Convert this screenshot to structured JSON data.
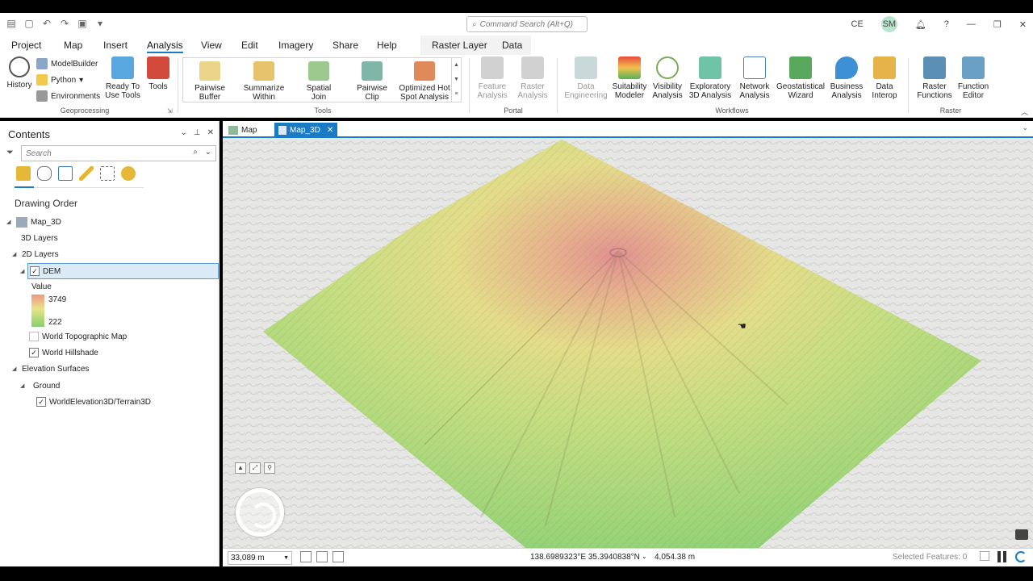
{
  "titlebar": {
    "command_search_placeholder": "Command Search (Alt+Q)",
    "user_initials": "CE",
    "avatar_initials": "SM",
    "help": "?"
  },
  "ribbon_tabs": [
    "Project",
    "Map",
    "Insert",
    "Analysis",
    "View",
    "Edit",
    "Imagery",
    "Share",
    "Help"
  ],
  "active_tab": "Analysis",
  "contextual_tabs": [
    "Raster Layer",
    "Data"
  ],
  "ribbon": {
    "geoprocessing": {
      "label": "Geoprocessing",
      "history": "History",
      "modelbuilder": "ModelBuilder",
      "python": "Python",
      "environments": "Environments",
      "ready_to_use": "Ready To Use Tools",
      "tools": "Tools"
    },
    "tools": {
      "label": "Tools",
      "items": [
        "Pairwise Buffer",
        "Summarize Within",
        "Spatial Join",
        "Pairwise Clip",
        "Optimized Hot Spot Analysis"
      ]
    },
    "portal": {
      "label": "Portal",
      "items": [
        "Feature Analysis",
        "Raster Analysis"
      ]
    },
    "workflows": {
      "label": "Workflows",
      "items": [
        "Data Engineering",
        "Suitability Modeler",
        "Visibility Analysis",
        "Exploratory 3D Analysis",
        "Network Analysis",
        "Geostatistical Wizard",
        "Business Analysis",
        "Data Interop"
      ]
    },
    "raster": {
      "label": "Raster",
      "items": [
        "Raster Functions",
        "Function Editor"
      ]
    }
  },
  "contents": {
    "title": "Contents",
    "search_placeholder": "Search",
    "drawing_order": "Drawing Order",
    "map_name": "Map_3D",
    "layers_3d": "3D Layers",
    "layers_2d": "2D Layers",
    "dem": "DEM",
    "value_label": "Value",
    "legend_high": "3749",
    "legend_low": "222",
    "topo": "World Topographic Map",
    "hillshade": "World Hillshade",
    "elevation_surfaces": "Elevation Surfaces",
    "ground": "Ground",
    "terrain": "WorldElevation3D/Terrain3D"
  },
  "map_tabs": [
    "Map",
    "Map_3D"
  ],
  "active_map_tab": "Map_3D",
  "status": {
    "scale": "33,089 m",
    "coordinates": "138.6989323°E 35.3940838°N",
    "elevation": "4,054.38 m",
    "selected_features": "Selected Features: 0"
  },
  "colors": {
    "accent": "#1a7bc4",
    "dem_high": "#e58a8a",
    "dem_mid": "#e6e07e",
    "dem_low": "#86cf6c"
  }
}
